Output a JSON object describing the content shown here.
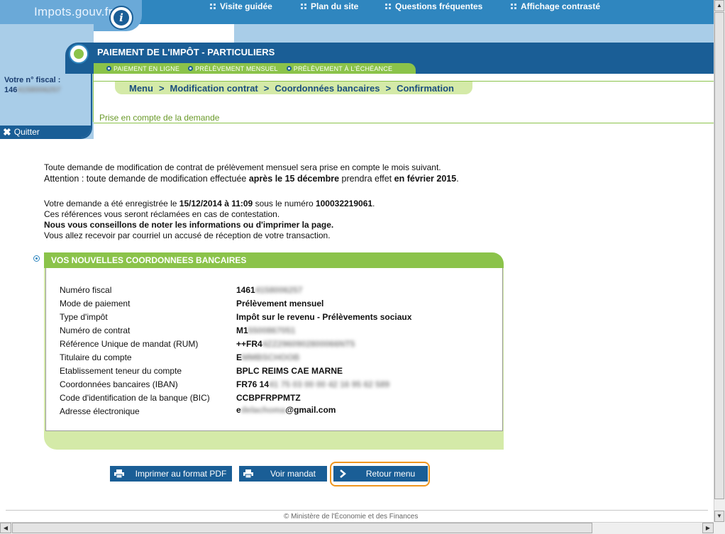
{
  "header": {
    "logo_text": "Impots.gouv.fr",
    "logo_badge": "i",
    "links": [
      {
        "label": "Visite guidée"
      },
      {
        "label": "Plan du site"
      },
      {
        "label": "Questions fréquentes"
      },
      {
        "label": "Affichage contrasté"
      }
    ]
  },
  "sidebar": {
    "fiscal_label": "Votre n° fiscal :",
    "fiscal_value_visible": "146",
    "fiscal_value_blurred": "4158006257",
    "quit_label": "Quitter"
  },
  "title": {
    "text": "PAIEMENT DE L'IMPÔT - PARTICULIERS"
  },
  "subnav": {
    "items": [
      {
        "label": "PAIEMENT EN LIGNE"
      },
      {
        "label": "PRÉLÈVEMENT MENSUEL"
      },
      {
        "label": "PRÉLÈVEMENT À L'ÉCHÉANCE"
      }
    ]
  },
  "breadcrumb": {
    "items": [
      "Menu",
      "Modification contrat",
      "Coordonnées bancaires",
      "Confirmation"
    ],
    "separator": ">"
  },
  "status_line": "Prise en compte de la demande",
  "message": {
    "line1": "Toute demande de modification de contrat de prélèvement mensuel sera prise en compte le mois suivant.",
    "line2_a": "Attention : toute demande de modification effectuée ",
    "line2_b": "après le 15 décembre",
    "line2_c": " prendra effet ",
    "line2_d": "en février 2015",
    "line2_e": ".",
    "line3_a": "Votre demande a été enregistrée le ",
    "line3_b": "15/12/2014 à 11:09",
    "line3_c": " sous le numéro ",
    "line3_d": "100032219061",
    "line3_e": ".",
    "line4": "Ces références vous seront réclamées en cas de contestation.",
    "line5": "Nous vous conseillons de noter les informations ou d'imprimer la page.",
    "line6": "Vous allez recevoir par courriel un accusé de réception de votre transaction."
  },
  "card": {
    "title": "VOS NOUVELLES COORDONNEES BANCAIRES",
    "rows": [
      {
        "label": "Numéro fiscal",
        "value": "1461",
        "blurred": "4158006257"
      },
      {
        "label": "Mode de paiement",
        "value": "Prélèvement mensuel",
        "blurred": ""
      },
      {
        "label": "Type d'impôt",
        "value": "Impôt sur le revenu - Prélèvements sociaux",
        "blurred": ""
      },
      {
        "label": "Numéro de contrat",
        "value": "M1",
        "blurred": "5500867051"
      },
      {
        "label": "Référence Unique de mandat (RUM)",
        "value": "++FR4",
        "blurred": "4ZZ2960902800066NT5"
      },
      {
        "label": "Titulaire du compte",
        "value": "E",
        "blurred": "MMBSCHOOB"
      },
      {
        "label": "Etablissement teneur du compte",
        "value": "BPLC REIMS CAE MARNE",
        "blurred": ""
      },
      {
        "label": "Coordonnées bancaires (IBAN)",
        "value": "FR76 14",
        "blurred": "41 75 03 00 00 42 16 95 62 589"
      },
      {
        "label": "Code d'identification de la banque (BIC)",
        "value": "CCBPFRPPMTZ",
        "blurred": ""
      },
      {
        "label": "Adresse électronique",
        "value_before": "e",
        "blurred": "delachoma",
        "value_after": "@gmail.com"
      }
    ]
  },
  "buttons": {
    "print_pdf": "Imprimer au format PDF",
    "view_mandate": "Voir mandat",
    "back_menu": "Retour menu"
  },
  "footer": {
    "text": "© Ministère de l'Économie et des Finances"
  },
  "colors": {
    "dark_blue": "#1a5e96",
    "mid_blue": "#2f86bf",
    "light_blue": "#a9cde8",
    "green": "#8bc34a",
    "light_green": "#d4eaa8",
    "focus_orange": "#f0961e"
  }
}
